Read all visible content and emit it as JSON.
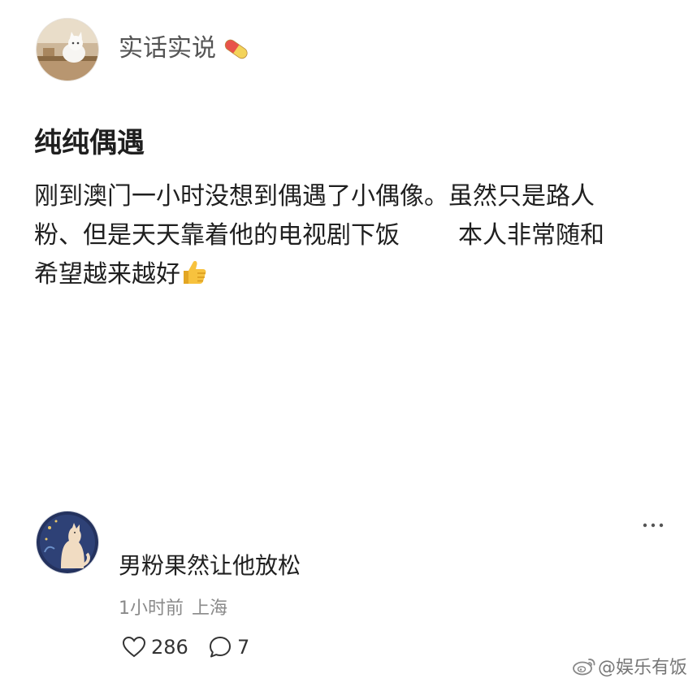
{
  "post": {
    "author": "实话实说",
    "title": "纯纯偶遇",
    "body_line1": "刚到澳门一小时没想到偶遇了小偶像。虽然只是路人",
    "body_line2_a": "粉、但是天天靠着他的电视剧下饭",
    "body_line2_b": "本人非常随和",
    "body_line3": "希望越来越好"
  },
  "comment": {
    "text": "男粉果然让他放松",
    "time": "1小时前",
    "location": "上海",
    "likes": "286",
    "replies": "7"
  },
  "watermark": {
    "text": "@娱乐有饭"
  },
  "icons": {
    "author_badge": "pill-emoji",
    "end_emoji": "thumbs-up-emoji",
    "more": "more-dots-icon",
    "like": "heart-outline-icon",
    "reply": "comment-bubble-icon",
    "watermark_logo": "weibo-logo"
  },
  "colors": {
    "text_primary": "#1f1f1f",
    "text_secondary": "#8a8a8a",
    "author_name": "#555555"
  }
}
